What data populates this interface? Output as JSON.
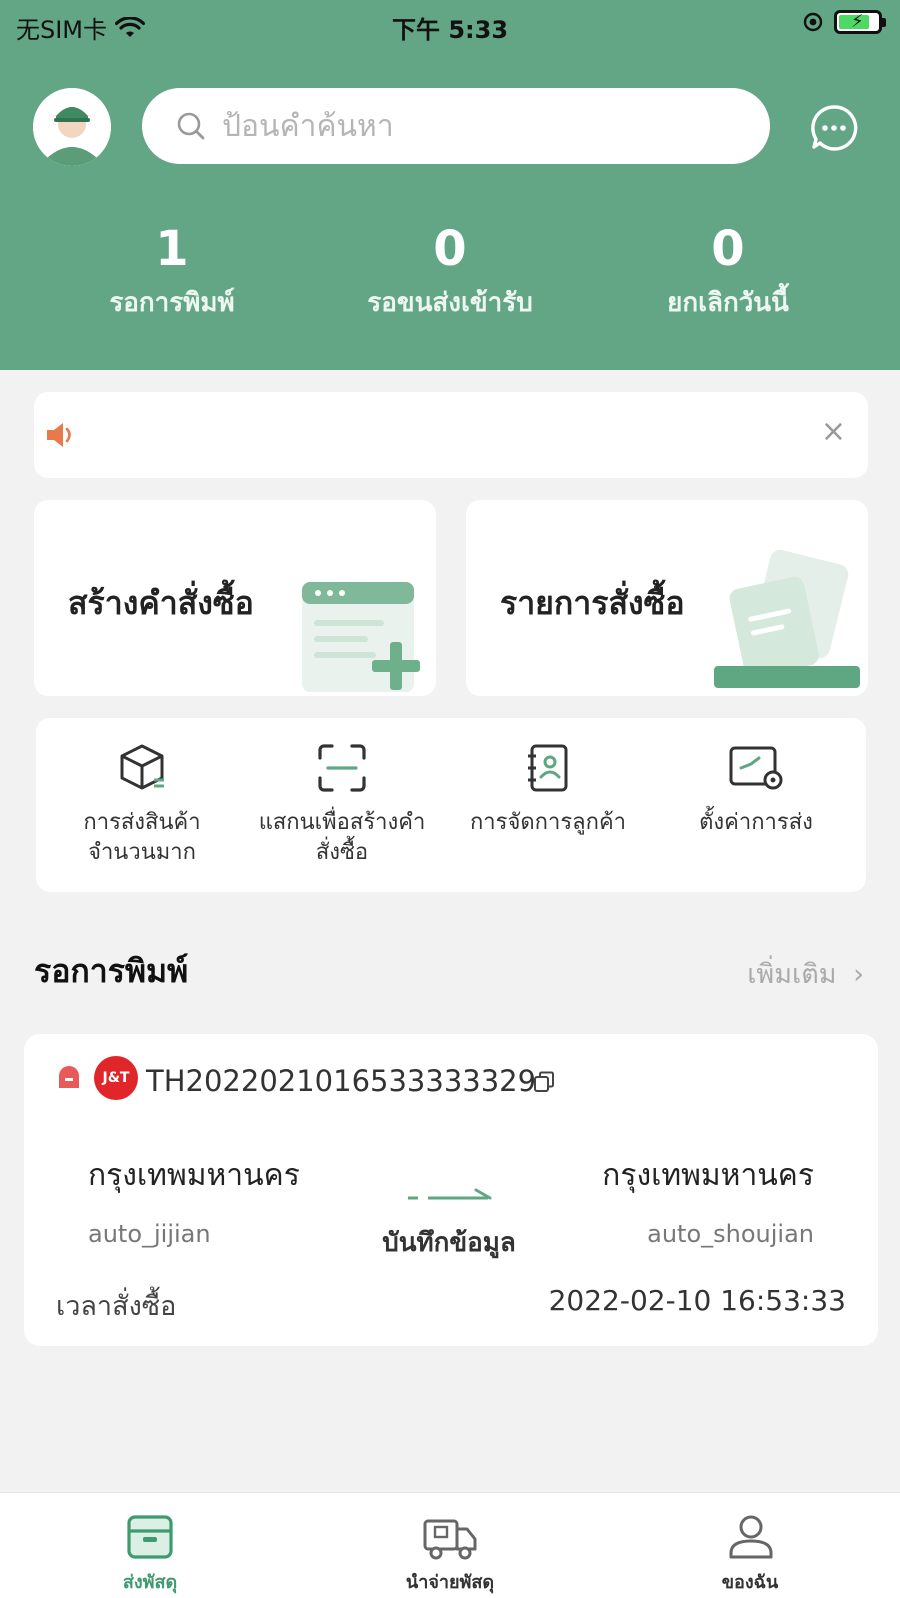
{
  "status_bar": {
    "carrier": "无SIM卡",
    "time": "下午 5:33"
  },
  "header": {
    "search_placeholder": "ป้อนคำค้นหา",
    "stats": [
      {
        "value": "1",
        "label": "รอการพิมพ์"
      },
      {
        "value": "0",
        "label": "รอขนส่งเข้ารับ"
      },
      {
        "value": "0",
        "label": "ยกเลิกวันนี้"
      }
    ]
  },
  "notice": {
    "close_icon": "×"
  },
  "cards": {
    "create_order": "สร้างคำสั่งซื้อ",
    "order_list": "รายการสั่งซื้อ"
  },
  "quick_actions": [
    {
      "label": "การส่งสินค้า\nจำนวนมาก",
      "icon": "box-icon"
    },
    {
      "label": "แสกนเพื่อสร้างคำ\nสั่งซื้อ",
      "icon": "scan-icon"
    },
    {
      "label": "การจัดการลูกค้า",
      "icon": "contacts-icon"
    },
    {
      "label": "ตั้งค่าการส่ง",
      "icon": "shipping-settings-icon"
    }
  ],
  "pending_section": {
    "title": "รอการพิมพ์",
    "more": "เพิ่มเติม",
    "more_chevron": "›"
  },
  "order": {
    "carrier_logo": "J&T",
    "tracking_no": "TH2022021016533333329",
    "from_city": "กรุงเทพมหานคร",
    "from_name": "auto_jijian",
    "to_city": "กรุงเทพมหานคร",
    "to_name": "auto_shoujian",
    "status": "บันทึกข้อมูล",
    "time_label": "เวลาสั่งซื้อ",
    "time_value": "2022-02-10 16:53:33"
  },
  "tabbar": [
    {
      "label": "ส่งพัสดุ",
      "active": true
    },
    {
      "label": "นำจ่ายพัสดุ",
      "active": false
    },
    {
      "label": "ของฉัน",
      "active": false
    }
  ],
  "colors": {
    "primary": "#62a686",
    "active_tab": "#3f9a70",
    "accent_red": "#e0262b",
    "speaker": "#e8794a"
  }
}
